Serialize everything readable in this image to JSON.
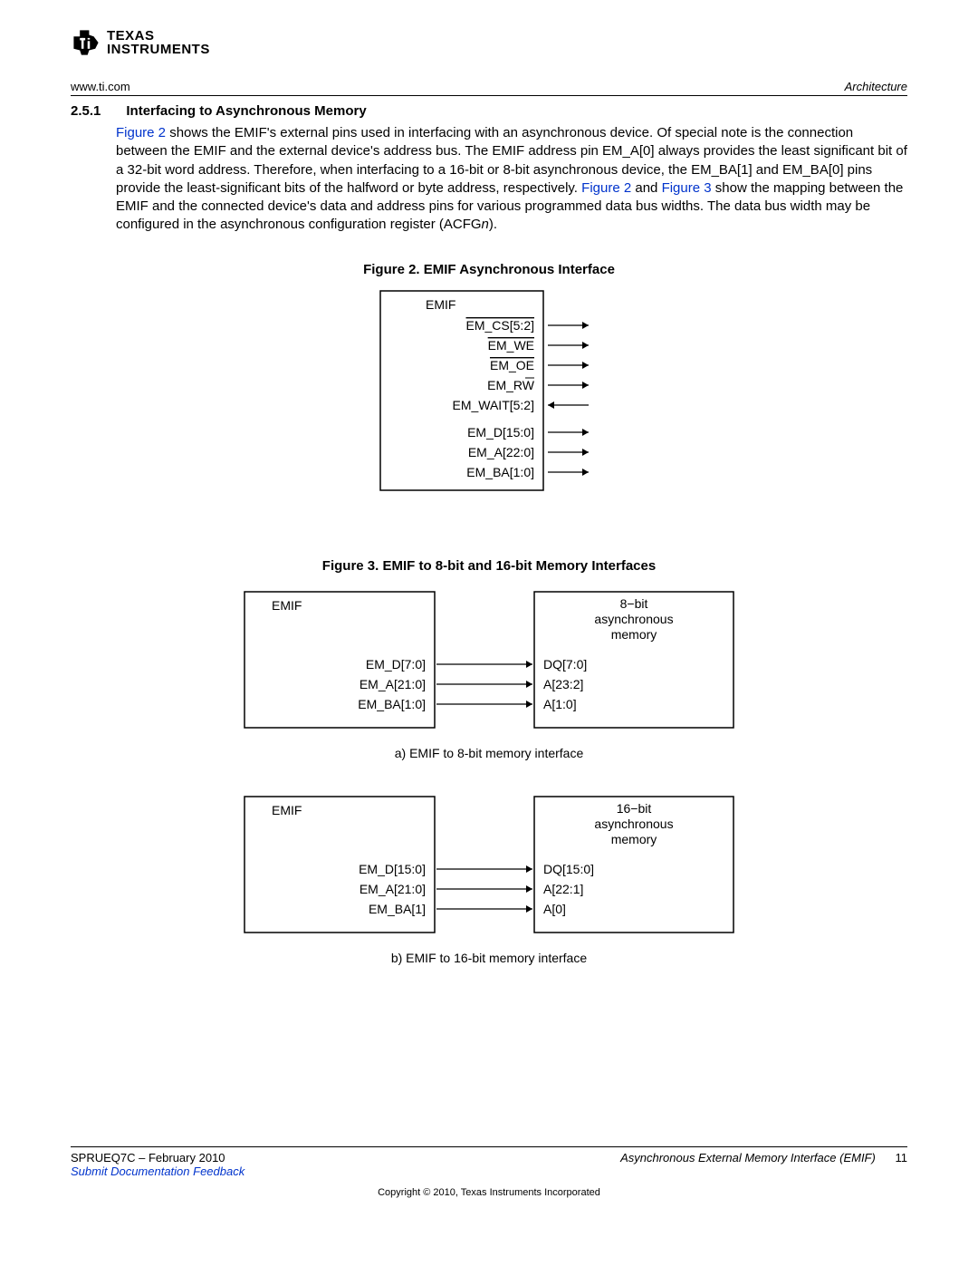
{
  "logo": {
    "line1": "TEXAS",
    "line2": "INSTRUMENTS"
  },
  "header": {
    "left": "www.ti.com",
    "right": "Architecture"
  },
  "section": {
    "number": "2.5.1",
    "title": "Interfacing to Asynchronous Memory"
  },
  "para": {
    "t1": " shows the EMIF's external pins used in interfacing with an asynchronous device. Of special note is the connection between the EMIF and the external device's address bus. The EMIF address pin EM_A[0] always provides the least significant bit of a 32-bit word address. Therefore, when interfacing to a 16-bit or 8-bit asynchronous device, the EM_BA[1] and EM_BA[0] pins provide the least-significant bits of the halfword or byte address, respectively. ",
    "t2": " and ",
    "t3": " show the mapping between the EMIF and the connected device's data and address pins for various programmed data bus widths. The data bus width may be configured in the asynchronous configuration register (ACFG",
    "t4": ").",
    "link_fig2": "Figure 2",
    "link_fig3": "Figure 3",
    "n": "n"
  },
  "fig2": {
    "caption": "Figure 2. EMIF Asynchronous Interface",
    "title": "EMIF",
    "signals": [
      {
        "label": "EM_CS[5:2]",
        "overline": true,
        "dir": "out"
      },
      {
        "label": "EM_WE",
        "overline": true,
        "dir": "out"
      },
      {
        "label": "EM_OE",
        "overline": true,
        "dir": "out"
      },
      {
        "label": "EM_RW",
        "overline": false,
        "overline_partial": true,
        "dir": "out"
      },
      {
        "label": "EM_WAIT[5:2]",
        "overline": false,
        "dir": "in"
      }
    ],
    "signals2": [
      {
        "label": "EM_D[15:0]",
        "dir": "out"
      },
      {
        "label": "EM_A[22:0]",
        "dir": "out"
      },
      {
        "label": "EM_BA[1:0]",
        "dir": "out"
      }
    ]
  },
  "fig3": {
    "caption": "Figure 3. EMIF to 8-bit and 16-bit Memory Interfaces",
    "sub_a": "a) EMIF to 8-bit memory interface",
    "sub_b": "b) EMIF to 16-bit memory interface",
    "a": {
      "left_title": "EMIF",
      "right_title1": "8−bit",
      "right_title2": "asynchronous",
      "right_title3": "memory",
      "rows": [
        {
          "l": "EM_D[7:0]",
          "r": "DQ[7:0]"
        },
        {
          "l": "EM_A[21:0]",
          "r": "A[23:2]"
        },
        {
          "l": "EM_BA[1:0]",
          "r": "A[1:0]"
        }
      ]
    },
    "b": {
      "left_title": "EMIF",
      "right_title1": "16−bit",
      "right_title2": "asynchronous",
      "right_title3": "memory",
      "rows": [
        {
          "l": "EM_D[15:0]",
          "r": "DQ[15:0]"
        },
        {
          "l": "EM_A[21:0]",
          "r": "A[22:1]"
        },
        {
          "l": "EM_BA[1]",
          "r": "A[0]"
        }
      ]
    }
  },
  "footer": {
    "left": "SPRUEQ7C – February 2010",
    "right": "Asynchronous External Memory Interface (EMIF)",
    "page": "11",
    "feedback": "Submit Documentation Feedback",
    "copyright": "Copyright © 2010, Texas Instruments Incorporated"
  }
}
